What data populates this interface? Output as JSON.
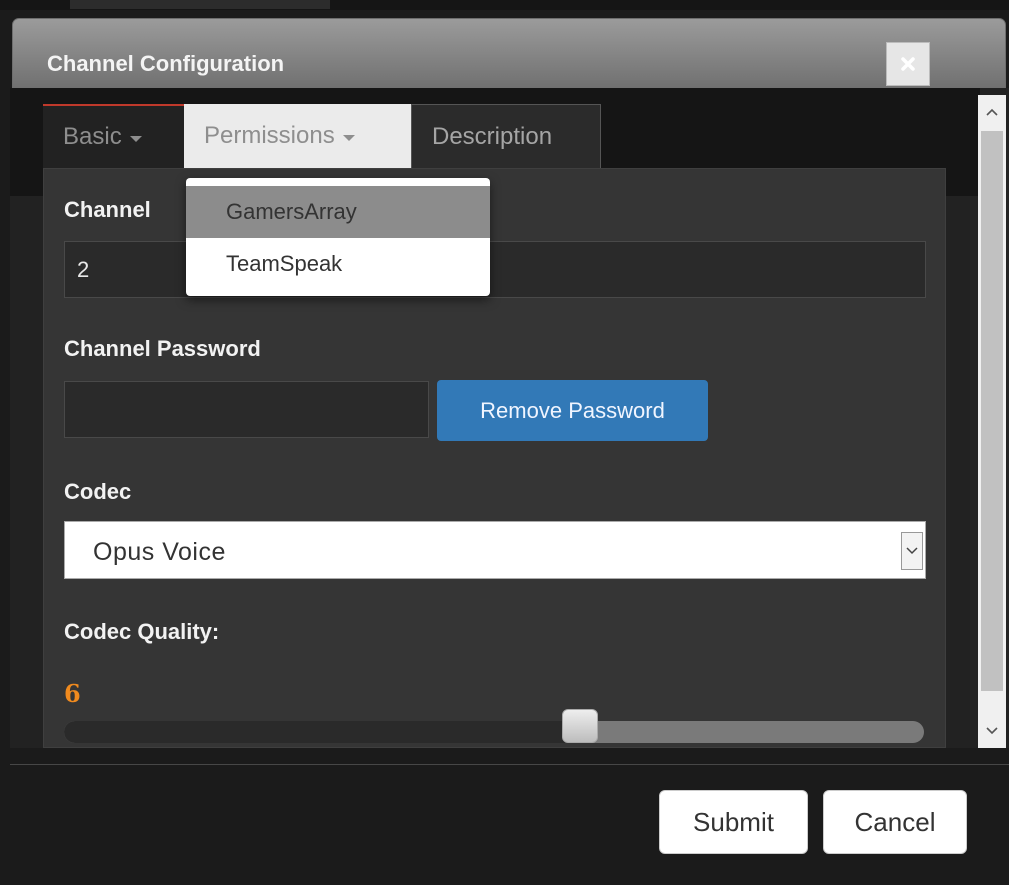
{
  "dialog": {
    "title": "Channel Configuration",
    "close_icon": "close-icon"
  },
  "tabs": [
    {
      "label": "Basic",
      "has_caret": true
    },
    {
      "label": "Permissions",
      "has_caret": true
    },
    {
      "label": "Description",
      "has_caret": false
    }
  ],
  "dropdown": {
    "items": [
      "GamersArray",
      "TeamSpeak"
    ],
    "highlighted": "GamersArray"
  },
  "form": {
    "channel_label": "Channel",
    "channel_value": "2",
    "password_label": "Channel Password",
    "password_value": "",
    "remove_password_label": "Remove Password",
    "codec_label": "Codec",
    "codec_value": "Opus Voice",
    "quality_label": "Codec Quality:",
    "quality_value": "6",
    "quality_fraction": 0.6
  },
  "footer": {
    "submit_label": "Submit",
    "cancel_label": "Cancel"
  },
  "colors": {
    "accent_blue": "#3279b7",
    "quality_orange": "#f08a1e",
    "active_tab_border": "#c0392b"
  }
}
